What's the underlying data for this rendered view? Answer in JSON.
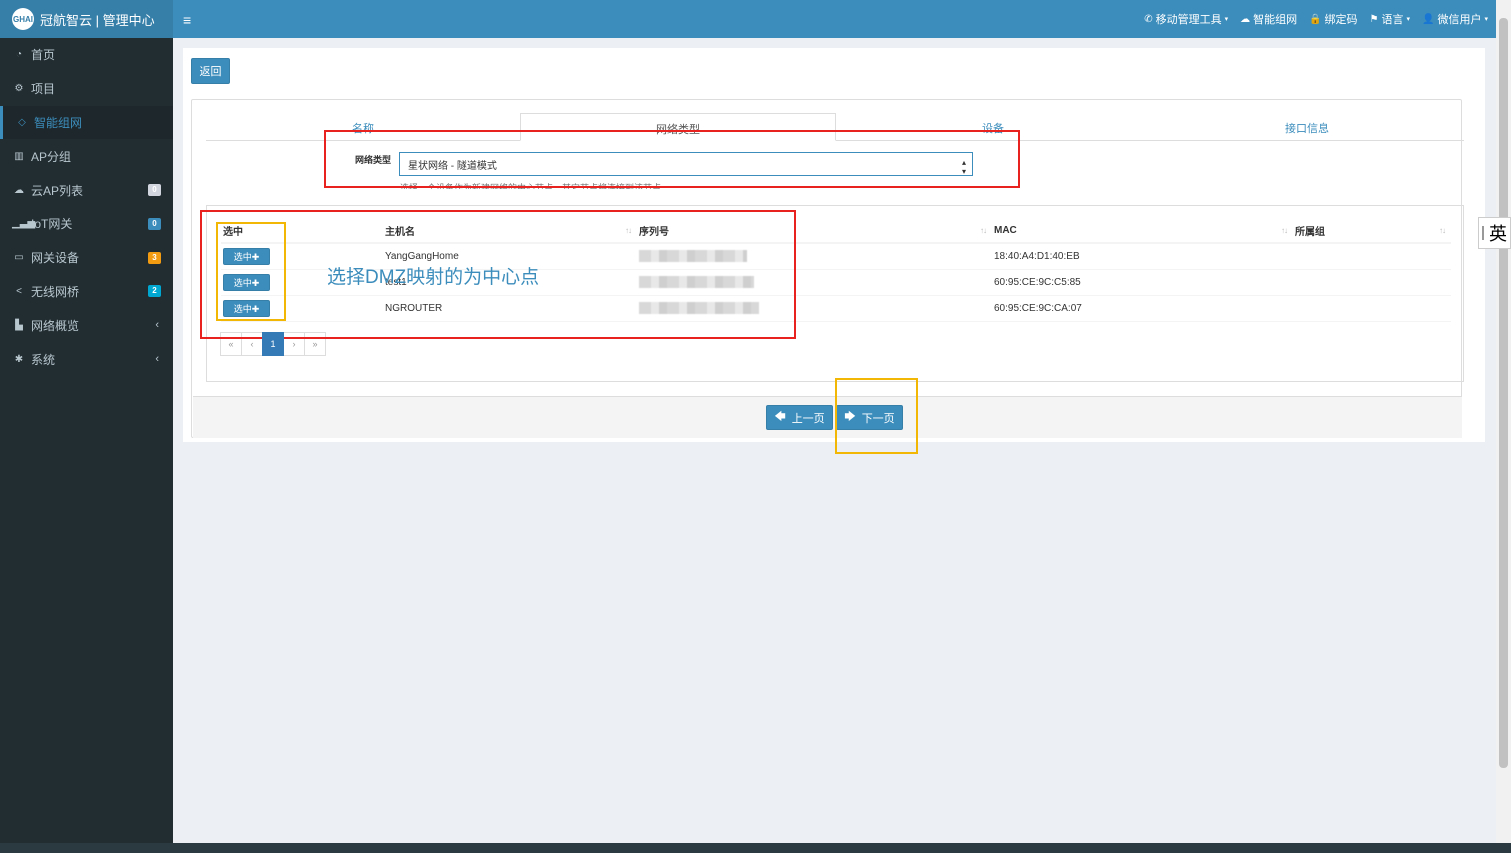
{
  "app": {
    "logo_mark": "GHAI",
    "title": "冠航智云 | 管理中心"
  },
  "sidebar": {
    "items": [
      {
        "label": "首页",
        "icon": "dashboard-icon",
        "glyph": "◔"
      },
      {
        "label": "项目",
        "icon": "cogs-icon",
        "glyph": "⚙"
      },
      {
        "label": "智能组网",
        "icon": "diamond-icon",
        "glyph": "◇",
        "active": true
      },
      {
        "label": "AP分组",
        "icon": "bank-icon",
        "glyph": "▥"
      },
      {
        "label": "云AP列表",
        "icon": "cloud-icon",
        "glyph": "☁",
        "badge": "0"
      },
      {
        "label": "IoT网关",
        "icon": "signal-icon",
        "glyph": "▁▃▅",
        "badge": "0"
      },
      {
        "label": "网关设备",
        "icon": "desktop-icon",
        "glyph": "▭",
        "badge": "3"
      },
      {
        "label": "无线网桥",
        "icon": "share-icon",
        "glyph": "<",
        "badge": "2"
      },
      {
        "label": "网络概览",
        "icon": "map-icon",
        "glyph": "▙",
        "chevron": "‹"
      },
      {
        "label": "系统",
        "icon": "gear-icon",
        "glyph": "✱",
        "chevron": "‹"
      }
    ]
  },
  "header": {
    "menu_glyph": "≡",
    "items": [
      {
        "label": "移动管理工具",
        "glyph": "✆",
        "caret": "▾"
      },
      {
        "label": "智能组网",
        "glyph": "☁"
      },
      {
        "label": "绑定码",
        "glyph": "🔒"
      },
      {
        "label": "语言",
        "glyph": "⚑",
        "caret": "▾"
      },
      {
        "label": "微信用户",
        "glyph": "👤",
        "caret": "▾"
      }
    ]
  },
  "content": {
    "back_label": "返回",
    "tabs": [
      "名称",
      "网络类型",
      "设备",
      "接口信息"
    ],
    "network_type_label": "网络类型",
    "network_type_value": "星状网络 - 隧道模式",
    "help_text": "选择一个设备作为新建网络的中心节点，其它节点将连接到该节点",
    "table": {
      "headers": [
        "选中",
        "主机名",
        "序列号",
        "MAC",
        "所属组"
      ],
      "sort_glyph": "↑↓",
      "rows": [
        {
          "select": "选中✚",
          "hostname": "YangGangHome",
          "mac": "18:40:A4:D1:40:EB",
          "group": ""
        },
        {
          "select": "选中✚",
          "hostname": "test1",
          "mac": "60:95:CE:9C:C5:85",
          "group": ""
        },
        {
          "select": "选中✚",
          "hostname": "NGROUTER",
          "mac": "60:95:CE:9C:CA:07",
          "group": ""
        }
      ]
    },
    "pager": [
      "«",
      "‹",
      "1",
      "›",
      "»"
    ],
    "prev_label": "上一页",
    "prev_glyph": "🡄",
    "next_label": "下一页",
    "next_glyph": "🡆"
  },
  "annotation": {
    "text": "选择DMZ映射的为中心点",
    "red": "#e8221e",
    "yellow": "#f2b705"
  },
  "ime": {
    "label": "英"
  }
}
